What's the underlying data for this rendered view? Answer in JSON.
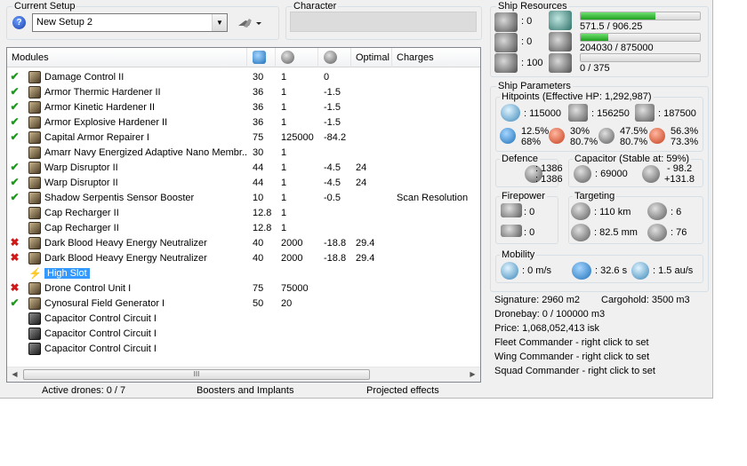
{
  "setup": {
    "group_title": "Current Setup",
    "selected": "New Setup 2",
    "help_icon": "question-icon",
    "tool_icon": "ship-tool-icon"
  },
  "character": {
    "group_title": "Character",
    "value": ""
  },
  "modules": {
    "headers": [
      "Modules",
      "",
      "",
      "",
      "Optimal",
      "Charges"
    ],
    "header_icons": [
      "cpu-icon",
      "powergrid-icon",
      "capacitor-icon"
    ],
    "rows": [
      {
        "status": "✔",
        "status_color": "#1a9a1a",
        "icon": "damage-control-icon",
        "name": "Damage Control II",
        "cpu": "30",
        "pg": "1",
        "cap": "0",
        "optimal": "",
        "charges": ""
      },
      {
        "status": "✔",
        "status_color": "#1a9a1a",
        "icon": "armor-hardener-icon",
        "name": "Armor Thermic Hardener II",
        "cpu": "36",
        "pg": "1",
        "cap": "-1.5",
        "optimal": "",
        "charges": ""
      },
      {
        "status": "✔",
        "status_color": "#1a9a1a",
        "icon": "armor-hardener-icon",
        "name": "Armor Kinetic Hardener II",
        "cpu": "36",
        "pg": "1",
        "cap": "-1.5",
        "optimal": "",
        "charges": ""
      },
      {
        "status": "✔",
        "status_color": "#1a9a1a",
        "icon": "armor-hardener-icon",
        "name": "Armor Explosive Hardener II",
        "cpu": "36",
        "pg": "1",
        "cap": "-1.5",
        "optimal": "",
        "charges": ""
      },
      {
        "status": "✔",
        "status_color": "#1a9a1a",
        "icon": "armor-repairer-icon",
        "name": "Capital Armor Repairer I",
        "cpu": "75",
        "pg": "125000",
        "cap": "-84.2",
        "optimal": "",
        "charges": ""
      },
      {
        "status": "",
        "status_color": "#1a9a1a",
        "icon": "membrane-icon",
        "name": "Amarr Navy Energized Adaptive Nano Membr...",
        "cpu": "30",
        "pg": "1",
        "cap": "",
        "optimal": "",
        "charges": ""
      },
      {
        "status": "✔",
        "status_color": "#1a9a1a",
        "icon": "warp-disruptor-icon",
        "name": "Warp Disruptor II",
        "cpu": "44",
        "pg": "1",
        "cap": "-4.5",
        "optimal": "24",
        "charges": ""
      },
      {
        "status": "✔",
        "status_color": "#1a9a1a",
        "icon": "warp-disruptor-icon",
        "name": "Warp Disruptor II",
        "cpu": "44",
        "pg": "1",
        "cap": "-4.5",
        "optimal": "24",
        "charges": ""
      },
      {
        "status": "✔",
        "status_color": "#1a9a1a",
        "icon": "sensor-booster-icon",
        "name": "Shadow Serpentis Sensor Booster",
        "cpu": "10",
        "pg": "1",
        "cap": "-0.5",
        "optimal": "",
        "charges": "Scan Resolution"
      },
      {
        "status": "",
        "status_color": "#1a9a1a",
        "icon": "cap-recharger-icon",
        "name": "Cap Recharger II",
        "cpu": "12.8",
        "pg": "1",
        "cap": "",
        "optimal": "",
        "charges": ""
      },
      {
        "status": "",
        "status_color": "#1a9a1a",
        "icon": "cap-recharger-icon",
        "name": "Cap Recharger II",
        "cpu": "12.8",
        "pg": "1",
        "cap": "",
        "optimal": "",
        "charges": ""
      },
      {
        "status": "✖",
        "status_color": "#d01818",
        "icon": "energy-neutralizer-icon",
        "name": "Dark Blood Heavy Energy Neutralizer",
        "cpu": "40",
        "pg": "2000",
        "cap": "-18.8",
        "optimal": "29.4",
        "charges": ""
      },
      {
        "status": "✖",
        "status_color": "#d01818",
        "icon": "energy-neutralizer-icon",
        "name": "Dark Blood Heavy Energy Neutralizer",
        "cpu": "40",
        "pg": "2000",
        "cap": "-18.8",
        "optimal": "29.4",
        "charges": ""
      },
      {
        "status": "",
        "status_color": "#1a9a1a",
        "icon": "high-slot-icon",
        "name": "High Slot",
        "cpu": "",
        "pg": "",
        "cap": "",
        "optimal": "",
        "charges": "",
        "selected": true
      },
      {
        "status": "✖",
        "status_color": "#d01818",
        "icon": "drone-control-icon",
        "name": "Drone Control Unit I",
        "cpu": "75",
        "pg": "75000",
        "cap": "",
        "optimal": "",
        "charges": ""
      },
      {
        "status": "✔",
        "status_color": "#1a9a1a",
        "icon": "cyno-field-icon",
        "name": "Cynosural Field Generator I",
        "cpu": "50",
        "pg": "20",
        "cap": "",
        "optimal": "",
        "charges": ""
      },
      {
        "status": "",
        "status_color": "#1a9a1a",
        "icon": "cap-control-circuit-icon",
        "name": "Capacitor Control Circuit I",
        "cpu": "",
        "pg": "",
        "cap": "",
        "optimal": "",
        "charges": ""
      },
      {
        "status": "",
        "status_color": "#1a9a1a",
        "icon": "cap-control-circuit-icon",
        "name": "Capacitor Control Circuit I",
        "cpu": "",
        "pg": "",
        "cap": "",
        "optimal": "",
        "charges": ""
      },
      {
        "status": "",
        "status_color": "#1a9a1a",
        "icon": "cap-control-circuit-icon",
        "name": "Capacitor Control Circuit I",
        "cpu": "",
        "pg": "",
        "cap": "",
        "optimal": "",
        "charges": ""
      }
    ],
    "scroll_grip": "III"
  },
  "statusbar": {
    "drones": "Active drones: 0 / 7",
    "boosters": "Boosters and Implants",
    "projected": "Projected effects"
  },
  "resources": {
    "title": "Ship Resources",
    "turret": ": 0",
    "launcher": ": 0",
    "drone_bw": ": 100",
    "cpu": "571.5 / 906.25",
    "cpu_fraction": 0.63,
    "powergrid": "204030 / 875000",
    "pg_fraction": 0.23,
    "calibration": "0 / 375",
    "cal_fraction": 0.0
  },
  "params": {
    "title": "Ship Parameters",
    "hitpoints_title": "Hitpoints (Effective HP: 1,292,987)",
    "shield_hp": ": 115000",
    "armor_hp": ": 156250",
    "structure_hp": ": 187500",
    "resists": [
      {
        "top": "12.5%",
        "bottom": "68%"
      },
      {
        "top": "30%",
        "bottom": "80.7%"
      },
      {
        "top": "47.5%",
        "bottom": "80.7%"
      },
      {
        "top": "56.3%",
        "bottom": "73.3%"
      }
    ],
    "defence_title": "Defence",
    "defence_top": ": 1386",
    "defence_bottom": ": 1386",
    "capacitor_title": "Capacitor (Stable at: 59%)",
    "capacitor_amount": ": 69000",
    "capacitor_delta_top": "- 98.2",
    "capacitor_delta_bottom": "+131.8",
    "firepower_title": "Firepower",
    "firepower_top": ": 0",
    "firepower_bottom": ": 0",
    "targeting_title": "Targeting",
    "target_range": ": 110 km",
    "max_targets": ": 6",
    "scan_res": ": 82.5 mm",
    "sensor_strength": ": 76",
    "mobility_title": "Mobility",
    "velocity": ": 0 m/s",
    "align_time": ": 32.6 s",
    "warp_speed": ": 1.5 au/s"
  },
  "info": {
    "signature": "Signature: 2960 m2",
    "cargohold": "Cargohold: 3500 m3",
    "dronebay": "Dronebay: 0 / 100000 m3",
    "price": "Price: 1,068,052,413 isk",
    "fleet": "Fleet Commander - right click to set",
    "wing": "Wing Commander - right click to set",
    "squad": "Squad Commander - right click to set"
  }
}
